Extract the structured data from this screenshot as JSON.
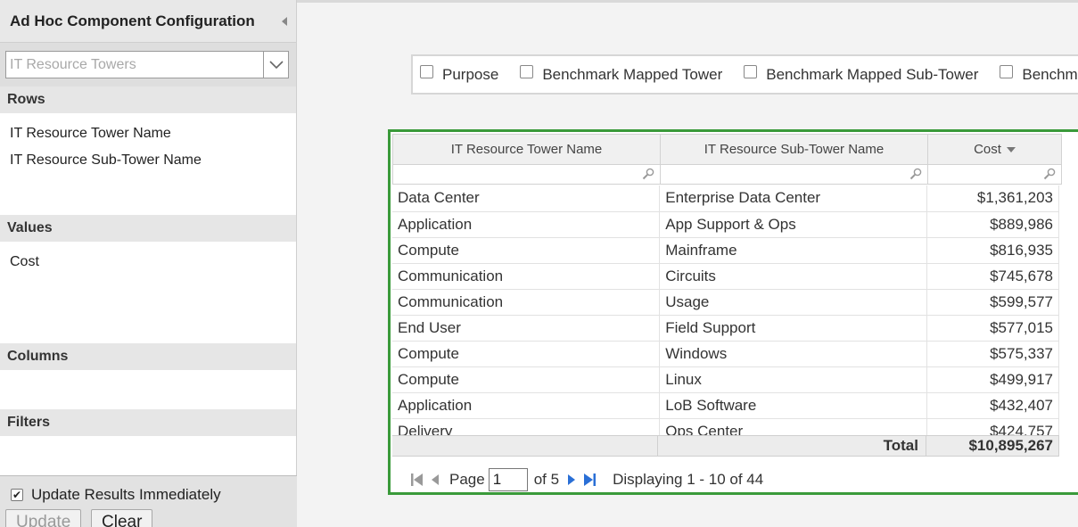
{
  "left": {
    "title": "Ad Hoc Component Configuration",
    "source_select": "IT Resource Towers",
    "sections": {
      "rows": {
        "label": "Rows",
        "items": [
          "IT Resource Tower Name",
          "IT Resource Sub-Tower Name"
        ]
      },
      "values": {
        "label": "Values",
        "items": [
          "Cost"
        ]
      },
      "columns": {
        "label": "Columns"
      },
      "filters": {
        "label": "Filters"
      }
    },
    "update_immediately_label": "Update Results Immediately",
    "update_immediately_checked": true,
    "update_button": "Update",
    "clear_button": "Clear"
  },
  "field_options": [
    "Purpose",
    "Benchmark Mapped Tower",
    "Benchmark Mapped Sub-Tower",
    "Benchmark"
  ],
  "grid": {
    "headers": [
      "IT Resource Tower Name",
      "IT Resource Sub-Tower Name",
      "Cost"
    ],
    "rows": [
      [
        "Data Center",
        "Enterprise Data Center",
        "$1,361,203"
      ],
      [
        "Application",
        "App Support & Ops",
        "$889,986"
      ],
      [
        "Compute",
        "Mainframe",
        "$816,935"
      ],
      [
        "Communication",
        "Circuits",
        "$745,678"
      ],
      [
        "Communication",
        "Usage",
        "$599,577"
      ],
      [
        "End User",
        "Field Support",
        "$577,015"
      ],
      [
        "Compute",
        "Windows",
        "$575,337"
      ],
      [
        "Compute",
        "Linux",
        "$499,917"
      ],
      [
        "Application",
        "LoB Software",
        "$432,407"
      ],
      [
        "Delivery",
        "Ops Center",
        "$424,757"
      ]
    ],
    "total_label": "Total",
    "total_value": "$10,895,267"
  },
  "pager": {
    "page_label": "Page",
    "page_value": "1",
    "of_label": "of 5",
    "display_text": "Displaying 1 - 10 of 44"
  },
  "colors": {
    "grid_border": "#3a9a3a",
    "pager_nav": "#2a6fd6"
  }
}
